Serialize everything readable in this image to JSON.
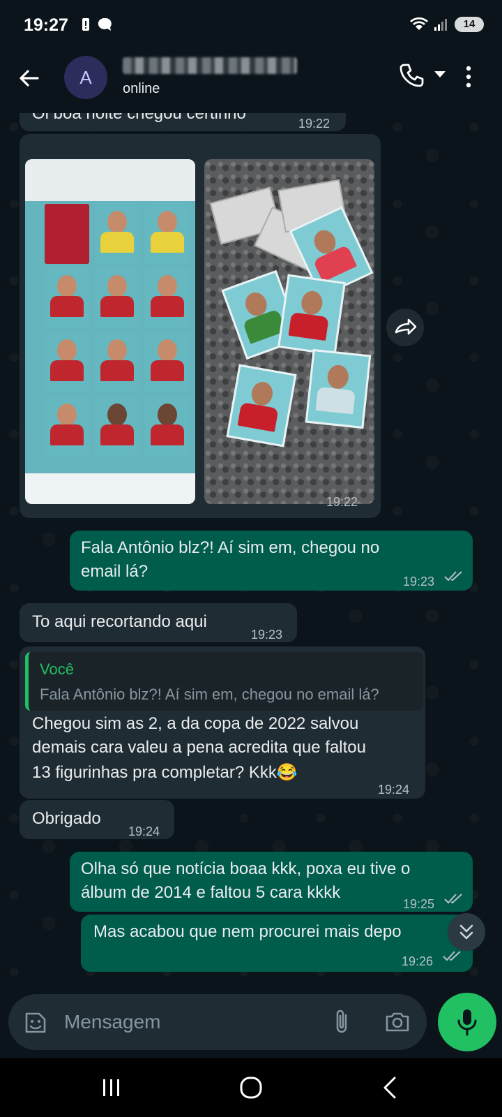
{
  "status_bar": {
    "time": "19:27",
    "battery": "14"
  },
  "header": {
    "avatar_letter": "A",
    "status": "online"
  },
  "messages": [
    {
      "dir": "in",
      "text": "Oi boa noite chegou certinho",
      "time": "19:22"
    },
    {
      "dir": "in",
      "type": "media",
      "time": "19:22"
    },
    {
      "dir": "out",
      "line1": "Fala Antônio blz?! Aí sim em, chegou no",
      "line2": "email lá?",
      "time": "19:23"
    },
    {
      "dir": "in",
      "text": "To aqui recortando aqui",
      "time": "19:23"
    },
    {
      "dir": "in",
      "quote_author": "Você",
      "quote_text": "Fala Antônio blz?! Aí sim em, chegou no email lá?",
      "line1": "Chegou sim as 2, a da copa de 2022 salvou",
      "line2": "demais cara valeu a pena acredita que faltou",
      "line3": "13 figurinhas pra completar? Kkk😂",
      "time": "19:24"
    },
    {
      "dir": "in",
      "text": "Obrigado",
      "time": "19:24"
    },
    {
      "dir": "out",
      "line1": "Olha só que notícia boaa kkk, poxa eu tive o",
      "line2": "álbum de 2014 e faltou 5 cara kkkk",
      "time": "19:25"
    },
    {
      "dir": "out",
      "text": "Mas acabou que nem procurei mais depo",
      "time": "19:26"
    }
  ],
  "composer": {
    "placeholder": "Mensagem"
  },
  "icons": {
    "back": "arrow-left-icon",
    "call": "phone-icon",
    "menu": "more-vert-icon",
    "forward": "forward-icon",
    "scroll_down": "double-chevron-down-icon",
    "sticker": "sticker-icon",
    "attach": "paperclip-icon",
    "camera": "camera-icon",
    "mic": "microphone-icon"
  },
  "colors": {
    "incoming": "#202c33",
    "outgoing": "#005c4b",
    "accent": "#21c063",
    "background": "#0b141a"
  }
}
